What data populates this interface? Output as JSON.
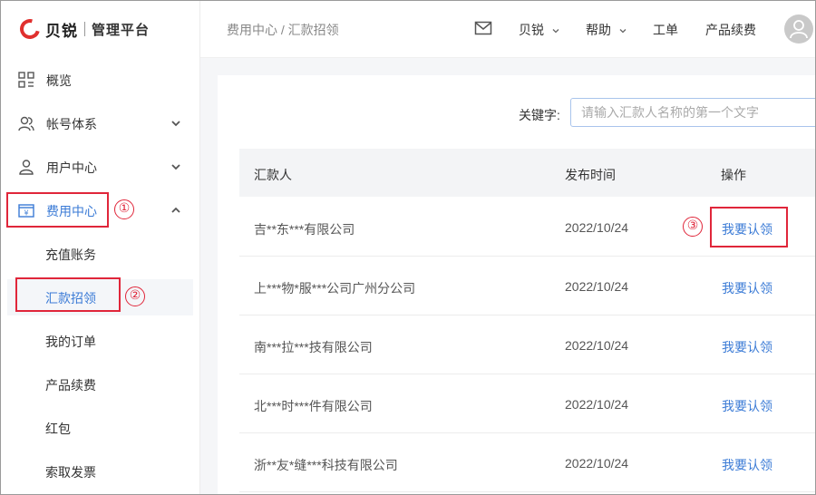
{
  "brand": {
    "name": "贝锐",
    "subtitle": "管理平台"
  },
  "sidebar": {
    "items": [
      {
        "label": "概览",
        "icon": "grid-icon"
      },
      {
        "label": "帐号体系",
        "icon": "users-icon",
        "chevron": "down"
      },
      {
        "label": "用户中心",
        "icon": "user-icon",
        "chevron": "down"
      },
      {
        "label": "费用中心",
        "icon": "yen-card-icon",
        "chevron": "up",
        "active": true
      }
    ],
    "sub_items": [
      {
        "label": "充值账务"
      },
      {
        "label": "汇款招领",
        "active": true
      },
      {
        "label": "我的订单"
      },
      {
        "label": "产品续费"
      },
      {
        "label": "红包"
      },
      {
        "label": "索取发票"
      }
    ]
  },
  "header": {
    "breadcrumb": "费用中心 / 汇款招领",
    "links": [
      {
        "label": "贝锐",
        "dropdown": true
      },
      {
        "label": "帮助",
        "dropdown": true
      },
      {
        "label": "工单"
      },
      {
        "label": "产品续费"
      }
    ]
  },
  "search": {
    "label": "关键字:",
    "placeholder": "请输入汇款人名称的第一个文字",
    "value": ""
  },
  "table": {
    "columns": [
      "汇款人",
      "发布时间",
      "操作"
    ],
    "rows": [
      {
        "remitter": "吉**东***有限公司",
        "date": "2022/10/24",
        "action": "我要认领"
      },
      {
        "remitter": "上***物*服***公司广州分公司",
        "date": "2022/10/24",
        "action": "我要认领"
      },
      {
        "remitter": "南***拉***技有限公司",
        "date": "2022/10/24",
        "action": "我要认领"
      },
      {
        "remitter": "北***时***件有限公司",
        "date": "2022/10/24",
        "action": "我要认领"
      },
      {
        "remitter": "浙**友*缝***科技有限公司",
        "date": "2022/10/24",
        "action": "我要认领"
      }
    ]
  },
  "annotations": [
    "①",
    "②",
    "③"
  ],
  "colors": {
    "accent": "#3b7bd6",
    "brand_red": "#e0302e",
    "annotation_red": "#e0263a"
  }
}
